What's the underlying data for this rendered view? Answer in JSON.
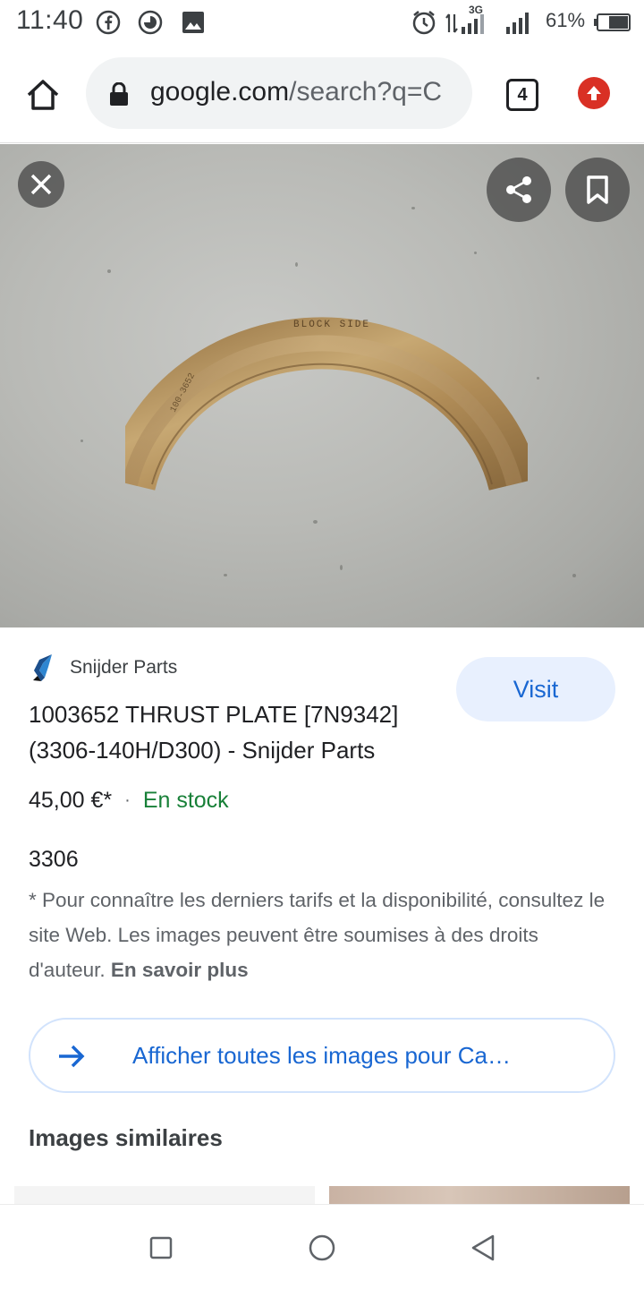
{
  "status_bar": {
    "time": "11:40",
    "battery_percent": "61%",
    "network_label": "3G"
  },
  "browser": {
    "url_domain": "google.com",
    "url_path": "/search?q=C",
    "tab_count": "4"
  },
  "result": {
    "source_name": "Snijder Parts",
    "visit_label": "Visit",
    "title": "1003652 THRUST PLATE [7N9342] (3306-140H/D300) - Snijder Parts",
    "price": "45,00 €*",
    "availability": "En stock",
    "model": "3306",
    "disclaimer": "* Pour connaître les derniers tarifs et la disponibilité, consultez le site Web. Les images peuvent être soumises à des droits d'auteur.",
    "learn_more": "En savoir plus",
    "all_images_label": "Afficher toutes les images pour Ca…",
    "similar_heading": "Images similaires",
    "image_engravings": {
      "top": "BLOCK SIDE",
      "side": "100-3652"
    }
  },
  "colors": {
    "accent_blue": "#1967d2",
    "stock_green": "#188038",
    "update_red": "#d93025"
  },
  "icons": {
    "status": [
      "facebook-icon",
      "data-saver-icon",
      "gallery-icon",
      "alarm-icon",
      "signal-icon",
      "battery-icon"
    ],
    "toolbar": [
      "home-icon",
      "lock-icon",
      "tabs-icon",
      "update-icon"
    ],
    "viewer": [
      "close-icon",
      "share-icon",
      "bookmark-icon"
    ],
    "nav": [
      "recents-icon",
      "home-circle-icon",
      "back-icon"
    ]
  }
}
